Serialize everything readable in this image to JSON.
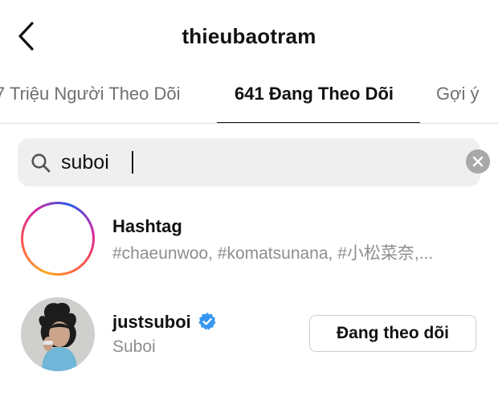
{
  "header": {
    "title": "thieubaotram",
    "back_icon": "chevron-left-icon"
  },
  "tabs": [
    {
      "label": "7 Triệu Người Theo Dõi",
      "active": false
    },
    {
      "label": "641 Đang Theo Dõi",
      "active": true
    },
    {
      "label": "Gợi ý",
      "active": false
    }
  ],
  "search": {
    "value": "suboi",
    "icon": "search-icon",
    "clear_icon": "clear-icon"
  },
  "results": {
    "hashtag": {
      "title": "Hashtag",
      "subtitle": "#chaeunwoo, #komatsunana, #小松菜奈,..."
    },
    "user": {
      "username": "justsuboi",
      "display_name": "Suboi",
      "verified": true,
      "button_label": "Đang theo dõi"
    }
  },
  "colors": {
    "text": "#111111",
    "muted": "#8e8e8e",
    "search_bg": "#efefef",
    "verified": "#3897f0"
  }
}
